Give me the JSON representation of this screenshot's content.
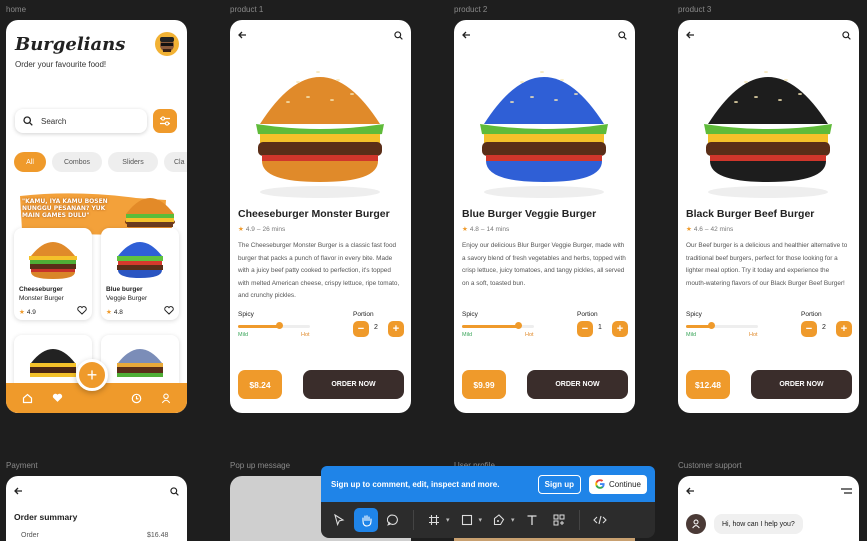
{
  "frames": {
    "home": "home",
    "product1": "product 1",
    "product2": "product 2",
    "product3": "product 3",
    "payment": "Payment",
    "popup": "Pop up message",
    "user_profile": "User profile",
    "support": "Customer support"
  },
  "home": {
    "brand": "Burgelians",
    "tagline": "Order your favourite food!",
    "search_label": "Search",
    "chips": [
      "All",
      "Combos",
      "Sliders",
      "Cla"
    ],
    "banner_text": "\"KAMU, IYA KAMU BOSEN NUNGGU PESANAN? YUK MAIN GAMES DULU\"",
    "cards": [
      {
        "title_line1": "Cheeseburger",
        "title_line2": "Monster Burger",
        "rating": "4.9"
      },
      {
        "title_line1": "Blue burger",
        "title_line2": "Veggie Burger",
        "rating": "4.8"
      }
    ],
    "fab_label": "+"
  },
  "products": [
    {
      "title": "Cheeseburger Monster Burger",
      "rating": "4.9",
      "time": "26 mins",
      "desc": "The Cheeseburger Monster Burger is a classic fast food burger that packs a punch of flavor in every bite. Made with a juicy beef patty cooked to perfection, it's topped with melted American cheese, crispy lettuce, ripe tomato, and crunchy pickles.",
      "spicy_level": 0.58,
      "qty": "2",
      "price": "$8.24",
      "bun_color": "#e08a2a"
    },
    {
      "title": "Blue Burger Veggie Burger",
      "rating": "4.8",
      "time": "14 mins",
      "desc": "Enjoy our delicious Blur Burger Veggie Burger, made with a savory blend of fresh vegetables and herbs, topped with crisp lettuce, juicy tomatoes, and tangy pickles, all served on a soft, toasted bun.",
      "spicy_level": 0.78,
      "qty": "1",
      "price": "$9.99",
      "bun_color": "#2f5fd6"
    },
    {
      "title": "Black Burger Beef Burger",
      "rating": "4.6",
      "time": "42 mins",
      "desc": "Our Beef burger is a delicious and healthier alternative to traditional beef burgers, perfect for those looking for a lighter meal option. Try it today and experience the mouth-watering flavors of our Black Burger Beef Burger!",
      "spicy_level": 0.35,
      "qty": "2",
      "price": "$12.48",
      "bun_color": "#1d1d1d"
    }
  ],
  "product_labels": {
    "spicy": "Spicy",
    "mild": "Mild",
    "hot": "Hot",
    "portion": "Portion",
    "minus": "−",
    "plus": "+",
    "order": "ORDER NOW"
  },
  "payment": {
    "title": "Order summary",
    "row_label": "Order",
    "row_value": "$16.48"
  },
  "support": {
    "message": "Hi, how can I help you?"
  },
  "overlay": {
    "message": "Sign up to comment, edit, inspect and more.",
    "signup": "Sign up",
    "continue": "Continue"
  },
  "colors": {
    "accent": "#ef9a2b",
    "dark_button": "#3a2d2b",
    "canvas": "#1e1e1e",
    "figma_blue": "#1f84e8"
  }
}
